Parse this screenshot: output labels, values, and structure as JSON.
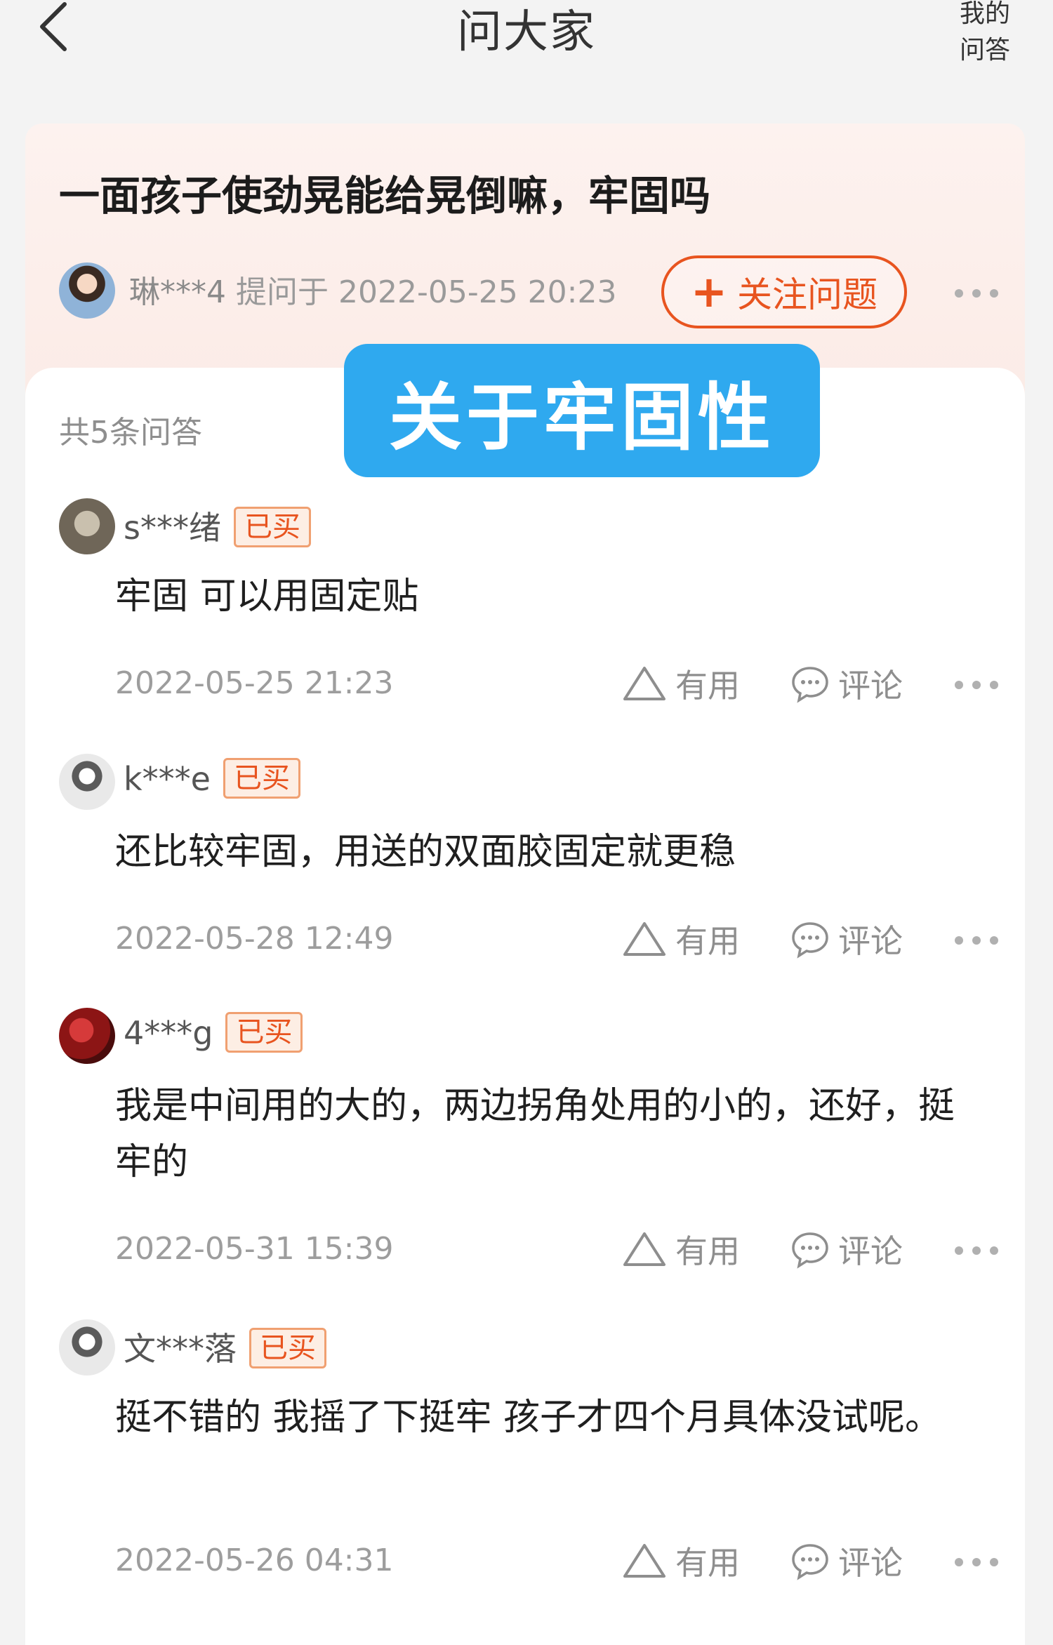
{
  "header": {
    "title": "问大家",
    "my_qa_line1": "我的",
    "my_qa_line2": "问答",
    "back_icon": "chevron-left-icon"
  },
  "question": {
    "title": "一面孩子使劲晃能给晃倒嘛，牢固吗",
    "asker_name": "琳***4",
    "asked_at": "提问于 2022-05-25 20:23",
    "follow_label": "关注问题",
    "follow_plus": "+",
    "accent_color": "#e8541f"
  },
  "answers_panel": {
    "count_label": "共5条问答",
    "topic_banner": "关于牢固性",
    "banner_color": "#2fa9ef"
  },
  "action_labels": {
    "useful": "有用",
    "comment": "评论"
  },
  "answers": [
    {
      "user": "s***绪",
      "badge": "已买",
      "text": "牢固 可以用固定贴",
      "date": "2022-05-25 21:23"
    },
    {
      "user": "k***e",
      "badge": "已买",
      "text": "还比较牢固，用送的双面胶固定就更稳",
      "date": "2022-05-28 12:49"
    },
    {
      "user": "4***g",
      "badge": "已买",
      "text": "我是中间用的大的，两边拐角处用的小的，还好，挺牢的",
      "date": "2022-05-31 15:39"
    },
    {
      "user": "文***落",
      "badge": "已买",
      "text": "挺不错的  我摇了下挺牢   孩子才四个月具体没试呢。",
      "date": "2022-05-26 04:31"
    }
  ]
}
